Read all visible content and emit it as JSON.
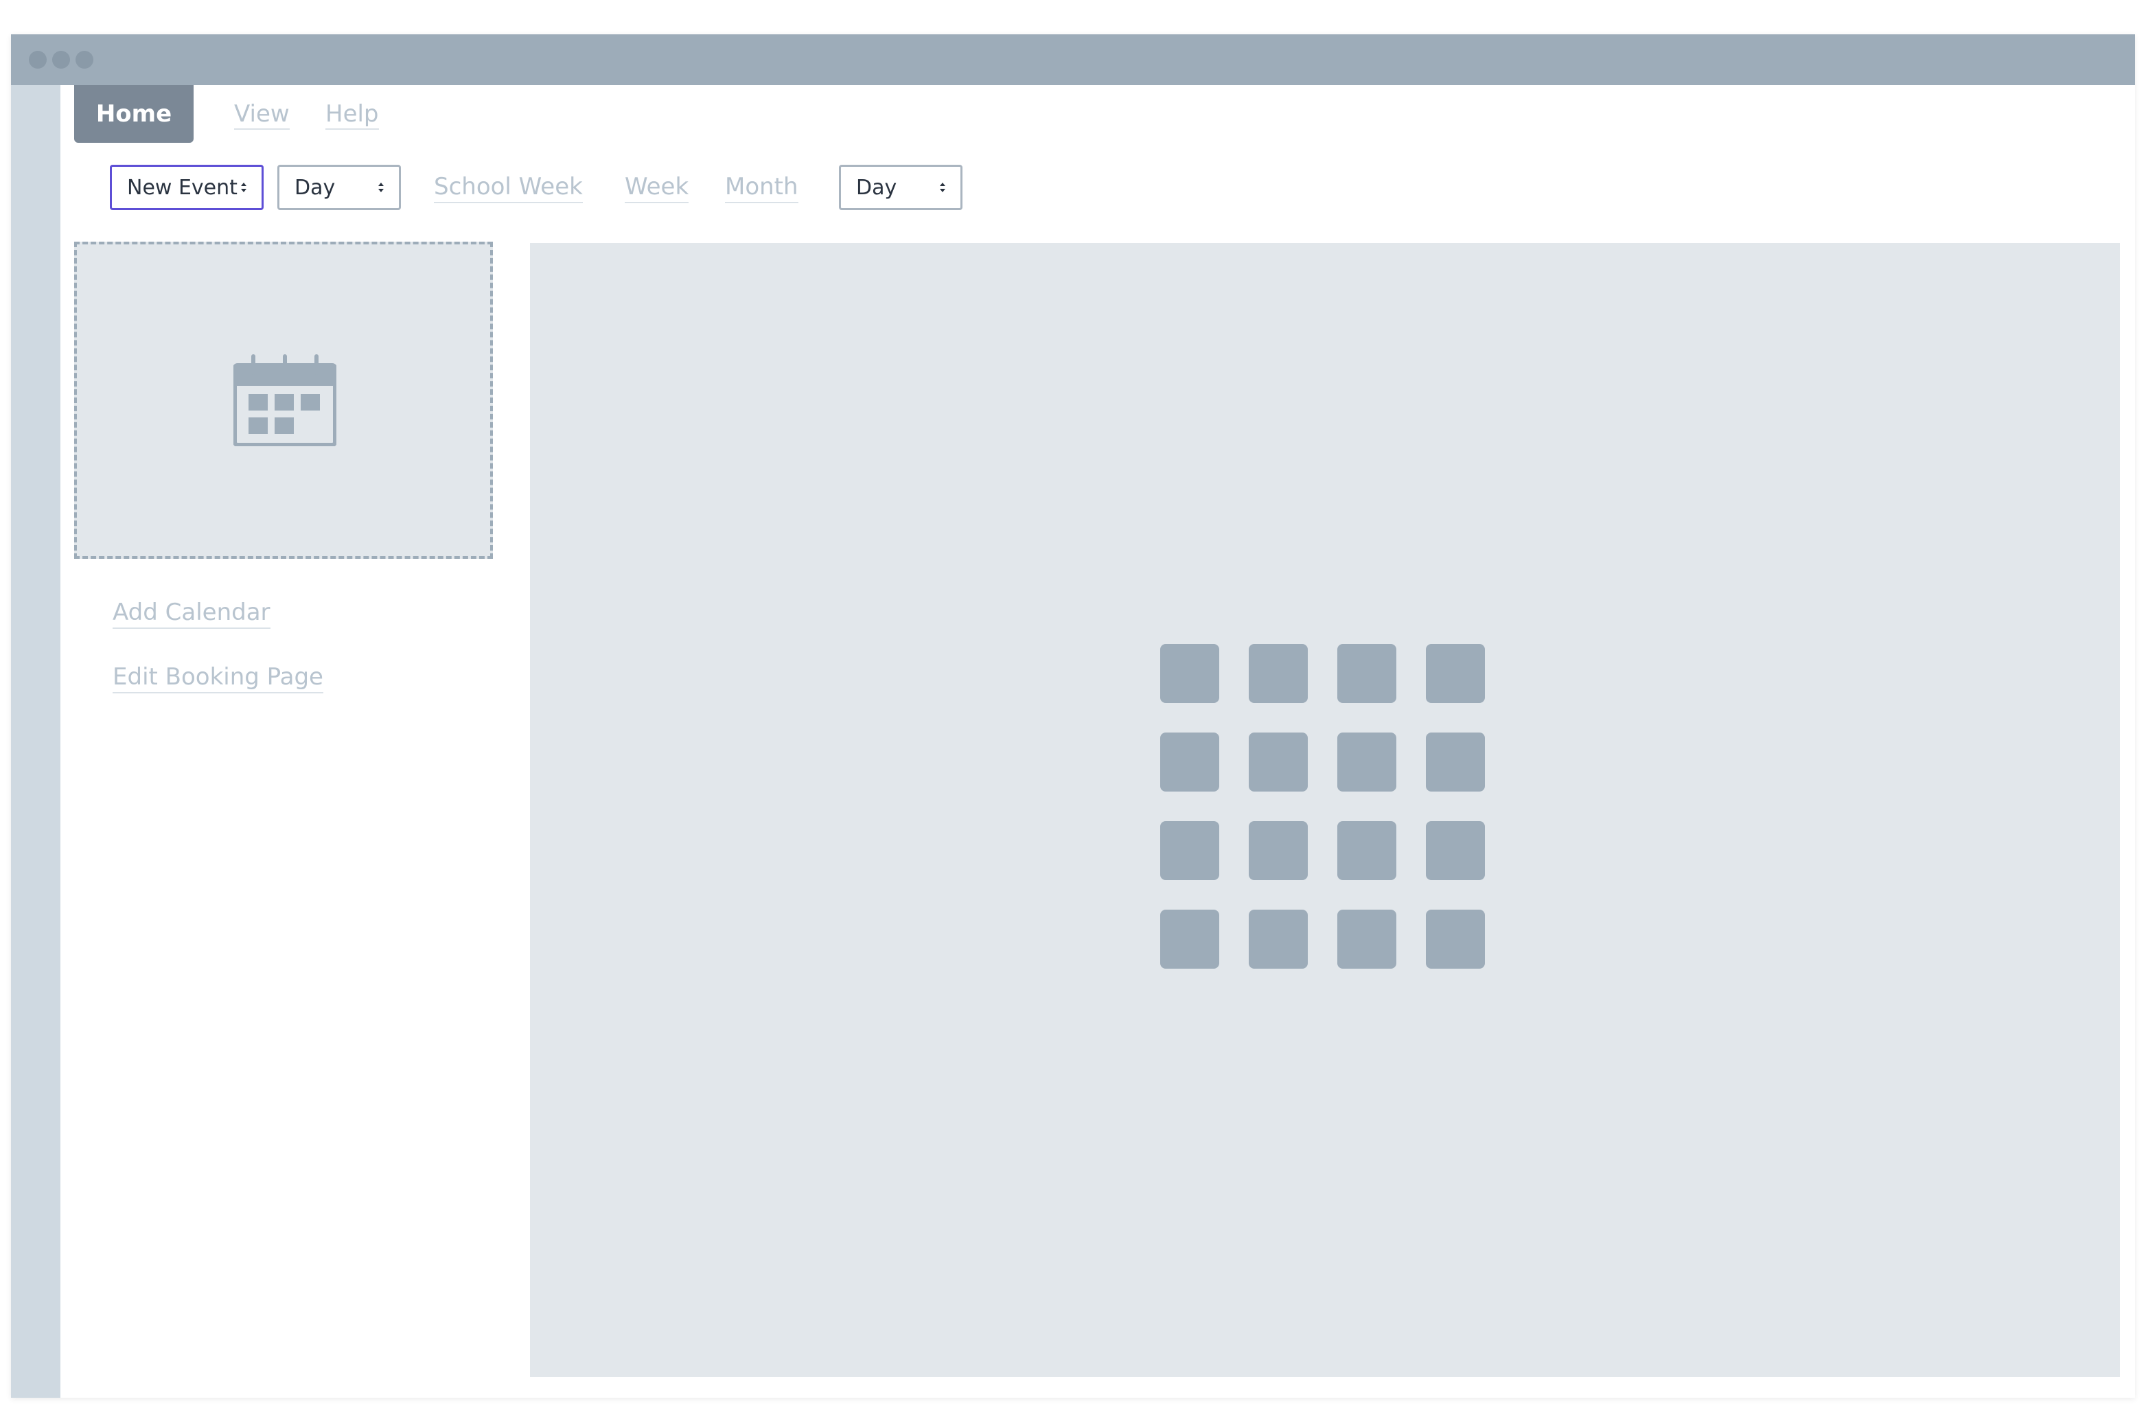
{
  "menu": {
    "home": "Home",
    "view": "View",
    "help": "Help"
  },
  "toolbar": {
    "new_event": "New Event",
    "day_select_1": "Day",
    "school_week": "School Week",
    "week": "Week",
    "month": "Month",
    "day_select_2": "Day"
  },
  "sidebar": {
    "calendar_icon": "calendar-icon",
    "add_calendar": "Add Calendar",
    "edit_booking_page": "Edit Booking Page"
  },
  "main": {
    "placeholder_icon": "grid-icon"
  },
  "colors": {
    "titlebar": "#9dacb9",
    "accent": "#5e4fd6",
    "home_tab": "#7b8896",
    "panel": "#e2e7eb"
  }
}
